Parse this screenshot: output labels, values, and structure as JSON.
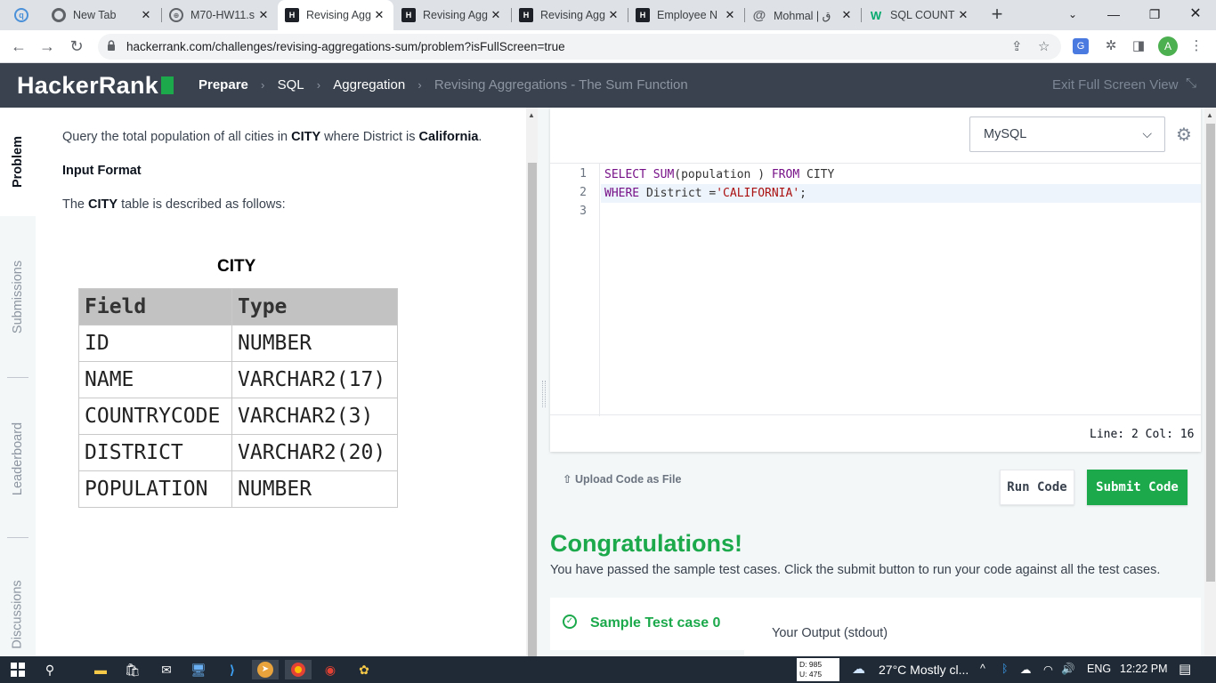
{
  "browser": {
    "tabs": [
      {
        "title": "",
        "icon": "qwant"
      },
      {
        "title": "New Tab",
        "icon": "chrome"
      },
      {
        "title": "M70-HW11.s",
        "icon": "globe"
      },
      {
        "title": "Revising Agg",
        "icon": "hackerrank",
        "active": true
      },
      {
        "title": "Revising Agg",
        "icon": "hackerrank"
      },
      {
        "title": "Revising Agg",
        "icon": "hackerrank"
      },
      {
        "title": "Employee N",
        "icon": "hackerrank"
      },
      {
        "title": "Mohmal | ق",
        "icon": "at"
      },
      {
        "title": "SQL COUNT",
        "icon": "w3schools"
      }
    ],
    "url": "hackerrank.com/challenges/revising-aggregations-sum/problem?isFullScreen=true",
    "profile_initial": "A"
  },
  "header": {
    "logo": "HackerRank",
    "breadcrumbs": [
      "Prepare",
      "SQL",
      "Aggregation"
    ],
    "current": "Revising Aggregations - The Sum Function",
    "exit_fullscreen": "Exit Full Screen View"
  },
  "side_tabs": [
    "Problem",
    "Submissions",
    "Leaderboard",
    "Discussions"
  ],
  "problem": {
    "statement_pre": "Query the total population of all cities in ",
    "statement_bold1": "CITY",
    "statement_mid": " where District is ",
    "statement_bold2": "California",
    "statement_post": ".",
    "input_format": "Input Format",
    "table_desc_pre": "The ",
    "table_desc_bold": "CITY",
    "table_desc_post": " table is described as follows:",
    "table_title": "CITY",
    "table_headers": [
      "Field",
      "Type"
    ],
    "table_rows": [
      [
        "ID",
        "NUMBER"
      ],
      [
        "NAME",
        "VARCHAR2(17)"
      ],
      [
        "COUNTRYCODE",
        "VARCHAR2(3)"
      ],
      [
        "DISTRICT",
        "VARCHAR2(20)"
      ],
      [
        "POPULATION",
        "NUMBER"
      ]
    ]
  },
  "editor": {
    "language": "MySQL",
    "line_numbers": [
      "1",
      "2",
      "3"
    ],
    "code_lines": [
      "SELECT SUM(population ) FROM CITY",
      "WHERE District ='CALIFORNIA';",
      ""
    ],
    "cursor_status": "Line: 2 Col: 16",
    "upload_label": "Upload Code as File",
    "run_label": "Run Code",
    "submit_label": "Submit Code"
  },
  "result": {
    "title": "Congratulations!",
    "message": "You have passed the sample test cases. Click the submit button to run your code against all the test cases.",
    "test_case": "Sample Test case 0",
    "output_label": "Your Output (stdout)"
  },
  "taskbar": {
    "net_down": "D: 985",
    "net_up": "U: 475",
    "weather": "27°C  Mostly cl...",
    "lang": "ENG",
    "time": "12:22 PM"
  },
  "colors": {
    "hr_header": "#39424e",
    "hr_green": "#1ba94c"
  }
}
